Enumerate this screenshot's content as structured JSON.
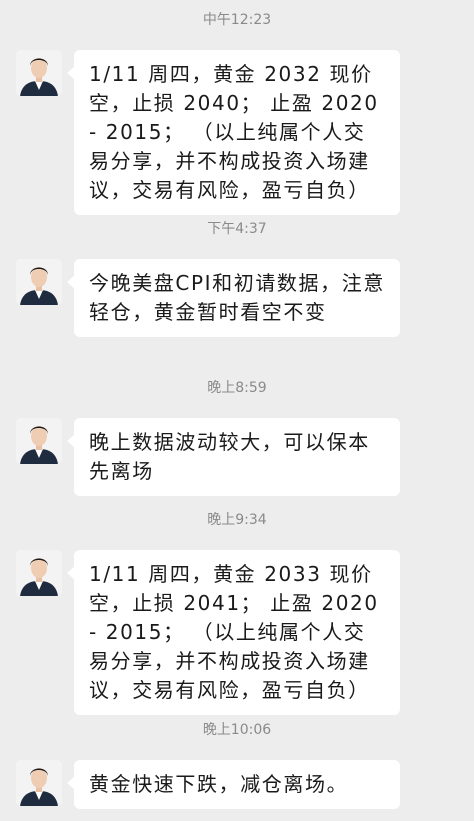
{
  "messages": [
    {
      "time": "中午12:23",
      "text": "1/11 周四，黄金 2032 现价空，止损 2040； 止盈 2020 - 2015； （以上纯属个人交易分享，并不构成投资入场建议，交易有风险，盈亏自负）"
    },
    {
      "time": "下午4:37",
      "text": "今晚美盘CPI和初请数据，注意轻仓，黄金暂时看空不变"
    },
    {
      "time": "晚上8:59",
      "text": "晚上数据波动较大，可以保本先离场"
    },
    {
      "time": "晚上9:34",
      "text": "1/11 周四，黄金 2033 现价空，止损 2041； 止盈 2020 - 2015； （以上纯属个人交易分享，并不构成投资入场建议，交易有风险，盈亏自负）"
    },
    {
      "time": "晚上10:06",
      "text": "黄金快速下跌，减仓离场。"
    }
  ]
}
